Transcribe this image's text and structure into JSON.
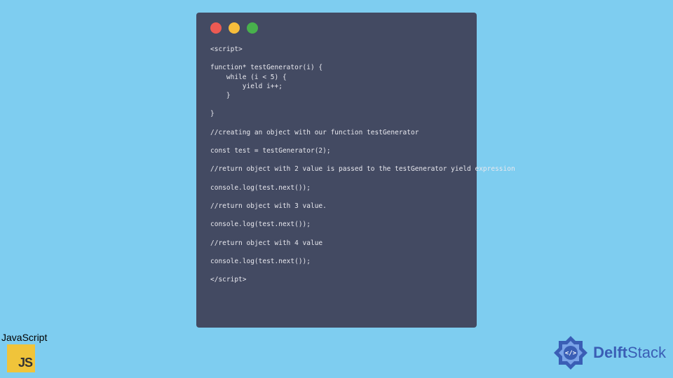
{
  "code": {
    "lines": [
      "<script>",
      "",
      "function* testGenerator(i) {",
      "    while (i < 5) {",
      "        yield i++;",
      "    }",
      "",
      "}",
      "",
      "//creating an object with our function testGenerator",
      "",
      "const test = testGenerator(2);",
      "",
      "//return object with 2 value is passed to the testGenerator yield expression",
      "",
      "console.log(test.next());",
      "",
      "//return object with 3 value.",
      "",
      "console.log(test.next());",
      "",
      "//return object with 4 value",
      "",
      "console.log(test.next());",
      "",
      "</script>"
    ]
  },
  "js_badge": {
    "label": "JavaScript",
    "logo_text": "JS"
  },
  "brand": {
    "name_part1": "Delft",
    "name_part2": "Stack"
  }
}
